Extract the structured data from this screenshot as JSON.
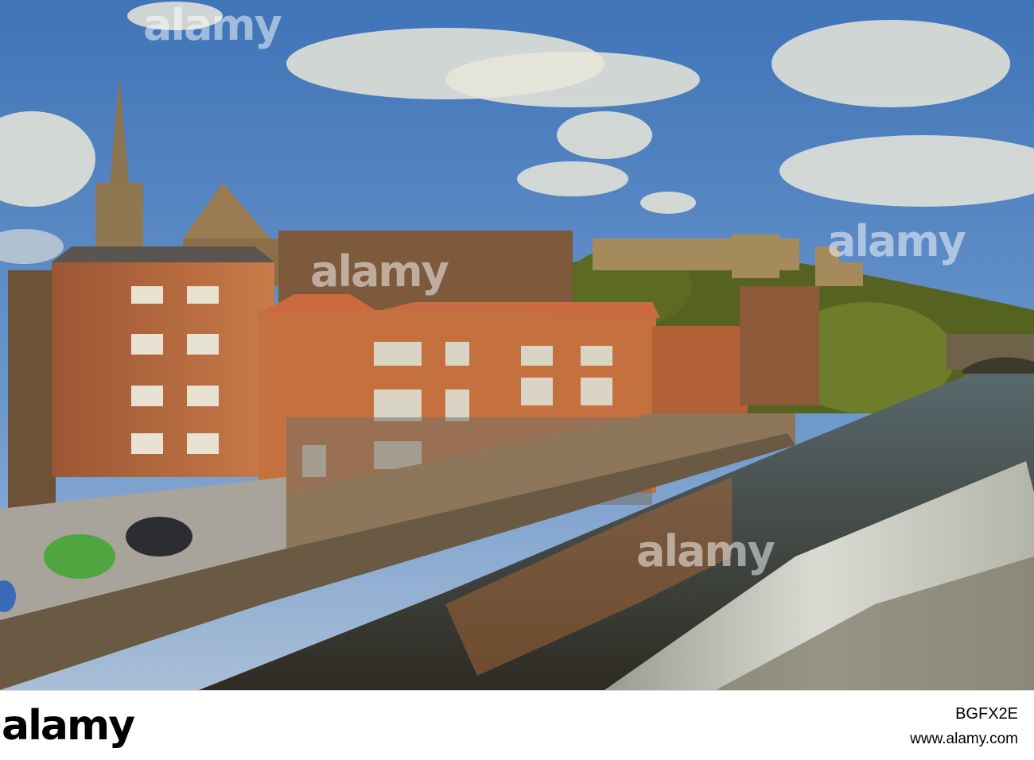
{
  "photo": {
    "subject": "River Wear with riverside apartments, church spire, Durham Castle and Cathedral on the hill, weir in foreground",
    "colors": {
      "sky_top": "#4a7fbf",
      "sky_bottom": "#8fb0d6",
      "brick": "#b86a3e",
      "roof": "#c76a45",
      "stone": "#a07a4f",
      "trees": "#6f7a2a",
      "water": "#3c3a2c",
      "weir_foam": "#cfd1c8"
    },
    "watermark": "alamy"
  },
  "footer": {
    "wordmark": "alamy",
    "stock_id": "BGFX2E",
    "url": "www.alamy.com"
  }
}
